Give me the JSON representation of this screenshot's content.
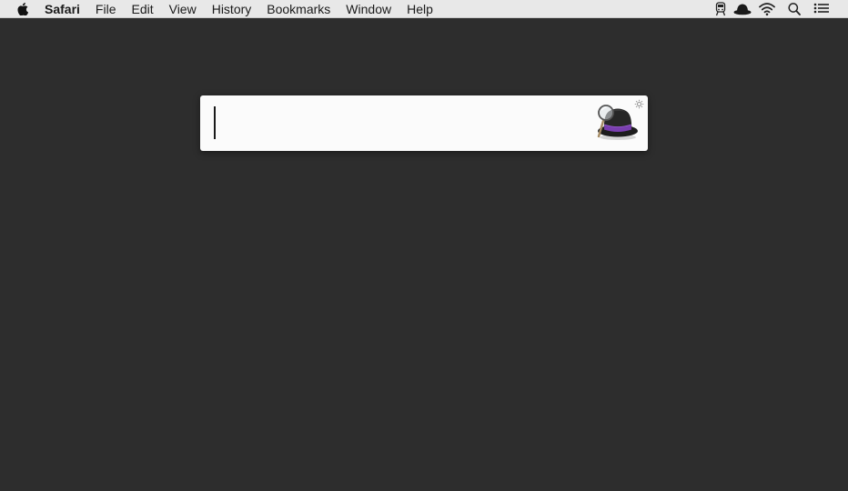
{
  "menubar": {
    "apple_menu": "apple-logo-icon",
    "app_name": "Safari",
    "items": [
      {
        "label": "File"
      },
      {
        "label": "Edit"
      },
      {
        "label": "View"
      },
      {
        "label": "History"
      },
      {
        "label": "Bookmarks"
      },
      {
        "label": "Window"
      },
      {
        "label": "Help"
      }
    ],
    "status_icons": [
      "train-icon",
      "alfred-hat-icon",
      "wifi-icon",
      "spotlight-search-icon",
      "notification-center-icon"
    ]
  },
  "alfred": {
    "query_value": "",
    "placeholder": "",
    "icons": {
      "logo": "alfred-hat-icon",
      "settings": "gear-icon"
    },
    "colors": {
      "background": "#fbfbfb",
      "hat_band": "#7a3fb0"
    }
  },
  "desktop": {
    "background_color": "#2d2d2d"
  }
}
